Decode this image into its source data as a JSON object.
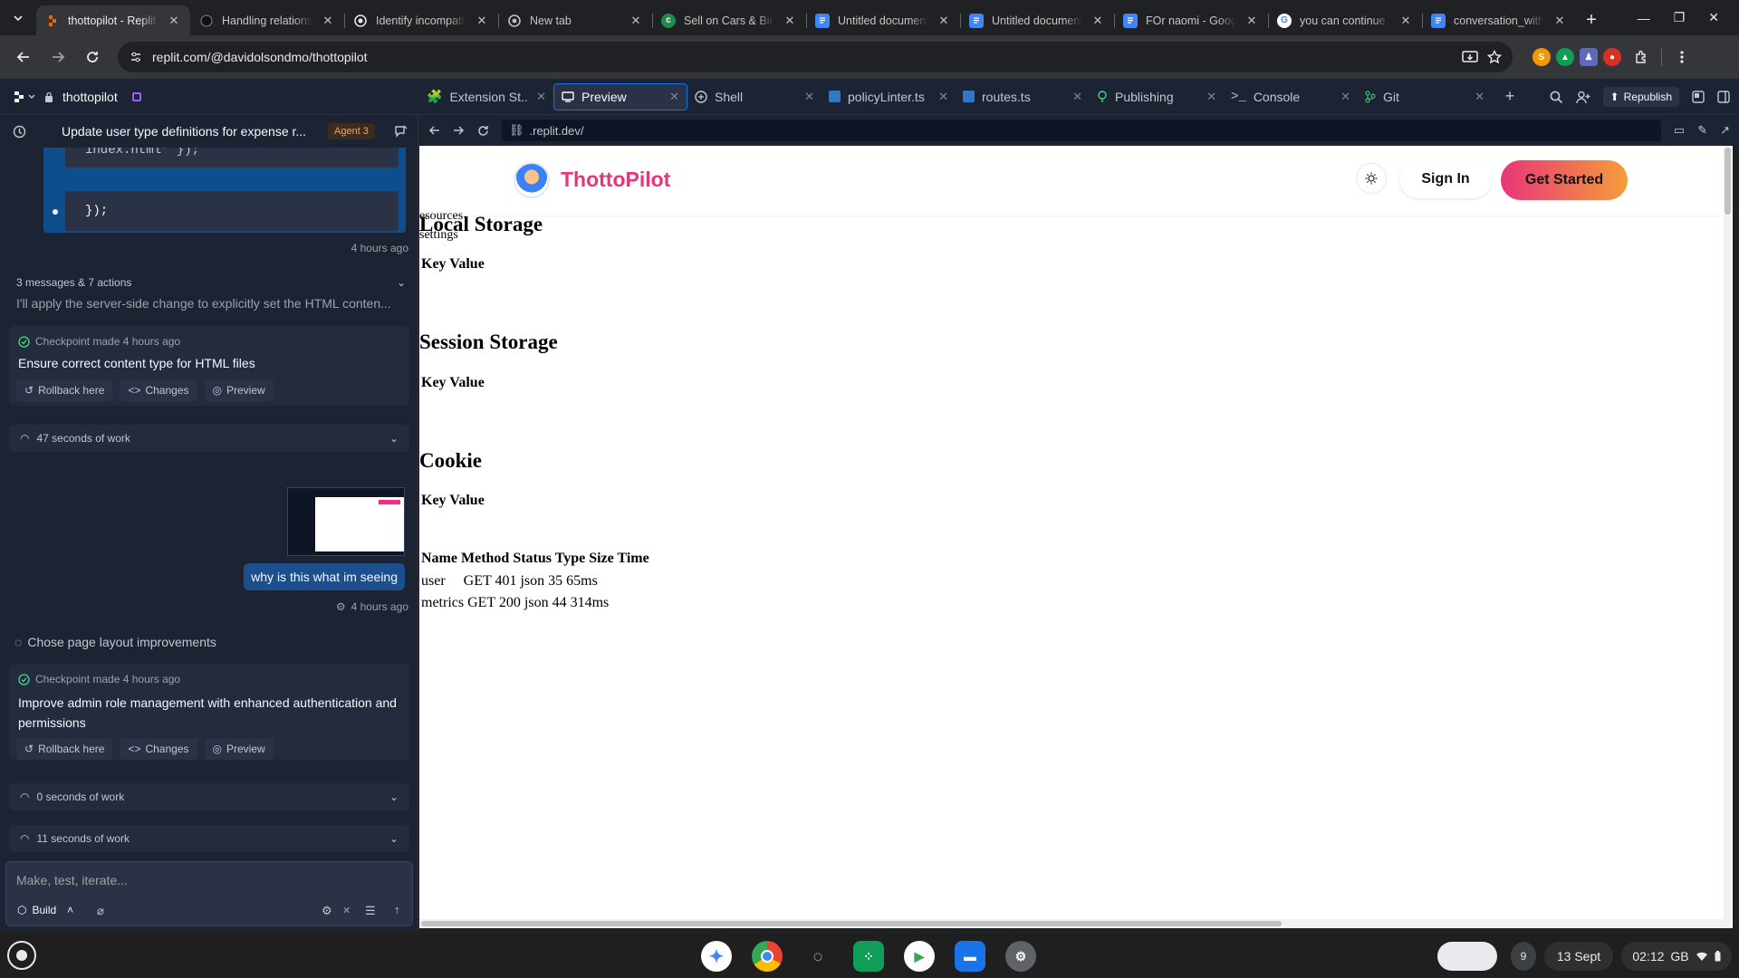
{
  "browser": {
    "tabs": [
      {
        "title": "thottopilot - Replit",
        "icon": "replit-icon",
        "active": true
      },
      {
        "title": "Handling relations",
        "icon": "chatgpt-icon"
      },
      {
        "title": "Identify incompati",
        "icon": "chatgpt-icon"
      },
      {
        "title": "New tab",
        "icon": "chrome-icon"
      },
      {
        "title": "Sell on Cars & Bids",
        "icon": "carsandbids-icon"
      },
      {
        "title": "Untitled document",
        "icon": "google-docs-icon"
      },
      {
        "title": "Untitled document",
        "icon": "google-docs-icon"
      },
      {
        "title": "FOr naomi - Googl",
        "icon": "google-docs-icon"
      },
      {
        "title": "you can continue",
        "icon": "google-icon"
      },
      {
        "title": "conversation_with",
        "icon": "google-docs-icon"
      }
    ],
    "url": "replit.com/@davidolsondmo/thottopilot"
  },
  "replit": {
    "project_name": "thottopilot",
    "tabs": [
      {
        "label": "Extension St...",
        "icon": "extension-icon"
      },
      {
        "label": "Preview",
        "icon": "monitor-icon",
        "active": true
      },
      {
        "label": "Shell",
        "icon": "shell-icon"
      },
      {
        "label": "policyLinter.ts",
        "icon": "typescript-icon"
      },
      {
        "label": "routes.ts",
        "icon": "typescript-icon"
      },
      {
        "label": "Publishing",
        "icon": "publishing-icon"
      },
      {
        "label": "Console",
        "icon": "console-icon"
      },
      {
        "label": "Git",
        "icon": "git-icon"
      }
    ],
    "republish_label": "Republish"
  },
  "chat": {
    "title": "Update user type definitions for expense r...",
    "agent_badge": "Agent 3",
    "code_line_partial": "index.html' });",
    "code_line": "});",
    "code_time": "4 hours ago",
    "summary_count": "3 messages & 7 actions",
    "summary_text": "I'll apply the server-side change to explicitly set the HTML conten...",
    "checkpoint1": {
      "meta": "Checkpoint made 4 hours ago",
      "title": "Ensure correct content type for HTML files",
      "rollback": "Rollback here",
      "changes": "Changes",
      "preview": "Preview"
    },
    "work1": "47 seconds of work",
    "user_message": "why is this what im seeing",
    "user_time": "4 hours ago",
    "layout_note": "Chose page layout improvements",
    "checkpoint2": {
      "meta": "Checkpoint made 4 hours ago",
      "title": "Improve admin role management with enhanced authentication and permissions",
      "rollback": "Rollback here",
      "changes": "Changes",
      "preview": "Preview"
    },
    "work2": "0 seconds of work",
    "work3": "11 seconds of work",
    "composer_placeholder": "Make, test, iterate...",
    "build_label": "Build"
  },
  "preview": {
    "url": ".replit.dev/",
    "brand": "ThottoPilot",
    "sign_in": "Sign In",
    "get_started": "Get Started",
    "overlap_text_1": "esources",
    "overlap_text_2": "settings",
    "local_storage": {
      "heading": "Local Storage",
      "header": "Key Value"
    },
    "session_storage": {
      "heading": "Session Storage",
      "header": "Key Value"
    },
    "cookie": {
      "heading": "Cookie",
      "header": "Key Value"
    },
    "network": {
      "header": "Name Method Status Type Size Time",
      "rows": [
        "user     GET 401 json 35 65ms",
        "metrics GET 200 json 44 314ms"
      ]
    }
  },
  "shelf": {
    "notification_count": "9",
    "date": "13 Sept",
    "time": "02:12",
    "locale": "GB"
  }
}
